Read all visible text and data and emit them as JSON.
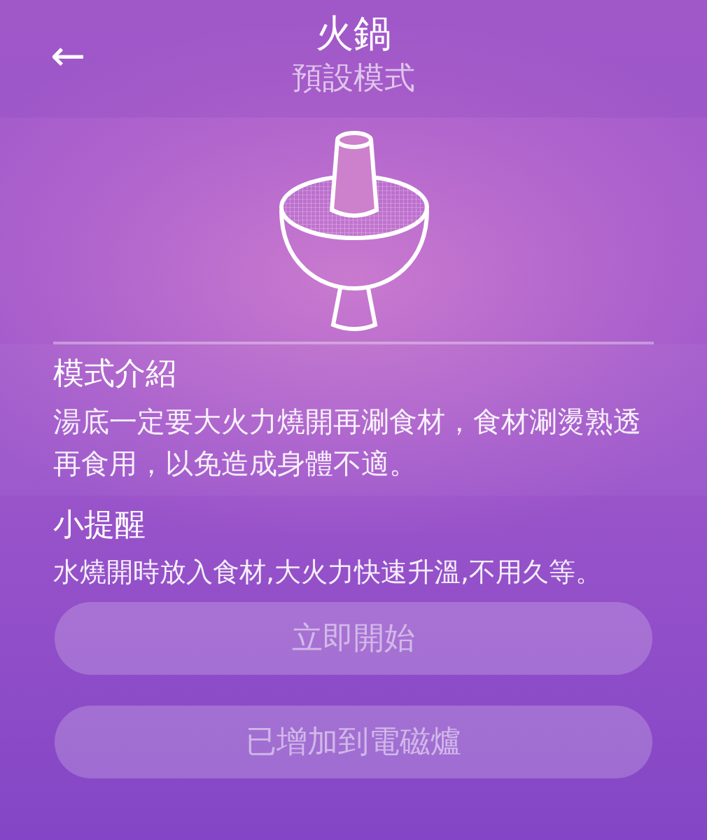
{
  "header": {
    "back": "←",
    "title": "火鍋",
    "subtitle": "預設模式"
  },
  "sections": [
    {
      "heading": "模式介紹",
      "text": "湯底一定要大火力燒開再涮食材，食材涮燙熟透再食用，以免造成身體不適。"
    },
    {
      "heading": "小提醒",
      "text": "水燒開時放入食材,大火力快速升溫,不用久等。"
    }
  ],
  "buttons": [
    {
      "label": "立即開始",
      "disabled": true
    },
    {
      "label": "已增加到電磁爐",
      "disabled": true
    }
  ]
}
